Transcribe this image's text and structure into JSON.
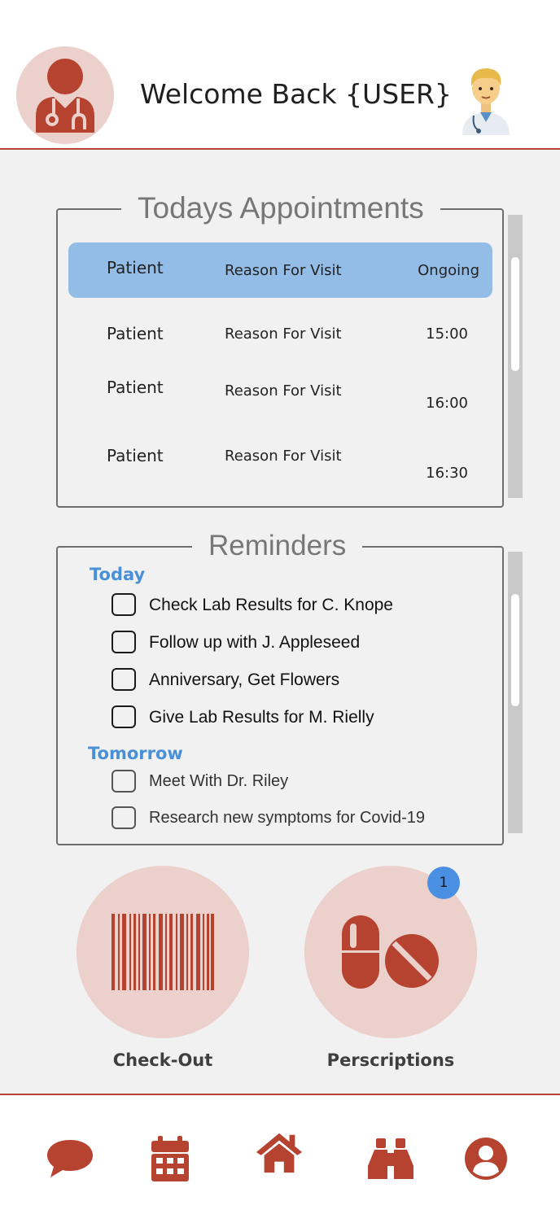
{
  "header": {
    "welcome_text": "Welcome Back {USER}",
    "avatar_icon": "doctor-stethoscope-icon",
    "emoji_icon": "man-health-worker-emoji"
  },
  "colors": {
    "accent": "#b5432f",
    "accent_light": "#ecd0cc",
    "highlight_row": "#93bde6",
    "group_label": "#4a90d6",
    "badge": "#4a90e2",
    "background": "#f1f1f1"
  },
  "appointments": {
    "title": "Todays Appointments",
    "rows": [
      {
        "patient": "Patient",
        "reason": "Reason For Visit",
        "time": "Ongoing",
        "active": true
      },
      {
        "patient": "Patient",
        "reason": "Reason For Visit",
        "time": "15:00",
        "active": false
      },
      {
        "patient": "Patient",
        "reason": "Reason For Visit",
        "time": "16:00",
        "active": false
      },
      {
        "patient": "Patient",
        "reason": "Reason For Visit",
        "time": "16:30",
        "active": false
      }
    ]
  },
  "reminders": {
    "title": "Reminders",
    "groups": [
      {
        "label": "Today",
        "items": [
          "Check Lab Results for C. Knope",
          "Follow up with J. Appleseed",
          "Anniversary, Get Flowers",
          "Give Lab Results for M. Rielly"
        ]
      },
      {
        "label": "Tomorrow",
        "items": [
          "Meet With Dr. Riley",
          "Research new symptoms for Covid-19"
        ]
      }
    ]
  },
  "actions": {
    "checkout": {
      "label": "Check-Out",
      "icon": "barcode-icon"
    },
    "prescriptions": {
      "label": "Perscriptions",
      "icon": "pills-icon",
      "badge": "1"
    }
  },
  "bottom_nav": [
    {
      "icon": "chat-bubble-icon"
    },
    {
      "icon": "calendar-icon"
    },
    {
      "icon": "home-icon"
    },
    {
      "icon": "binoculars-icon"
    },
    {
      "icon": "user-profile-icon"
    }
  ]
}
